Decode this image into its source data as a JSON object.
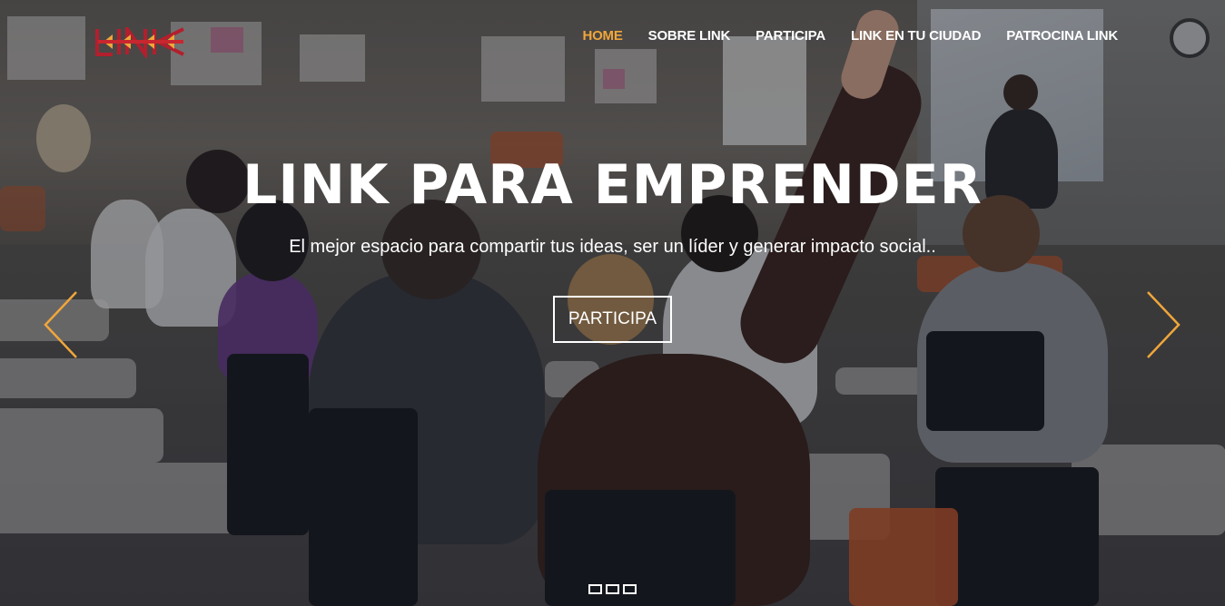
{
  "brand": {
    "logo_text": "LINK",
    "accent_color": "#f0a63a",
    "logo_color": "#b21f2d"
  },
  "navbar": {
    "items": [
      {
        "label": "HOME",
        "active": true
      },
      {
        "label": "SOBRE LINK",
        "active": false
      },
      {
        "label": "PARTICIPA",
        "active": false
      },
      {
        "label": "LINK EN TU CIUDAD",
        "active": false
      },
      {
        "label": "PATROCINA LINK",
        "active": false
      }
    ]
  },
  "hero": {
    "title": "LINK PARA EMPRENDER",
    "subtitle": "El mejor espacio para compartir tus ideas, ser un líder y generar impacto social..",
    "cta_label": "PARTICIPA"
  },
  "carousel": {
    "prev_icon": "chevron-left-icon",
    "next_icon": "chevron-right-icon",
    "arrow_color": "#f0a63a",
    "slide_count": 3,
    "active_slide": 1
  }
}
